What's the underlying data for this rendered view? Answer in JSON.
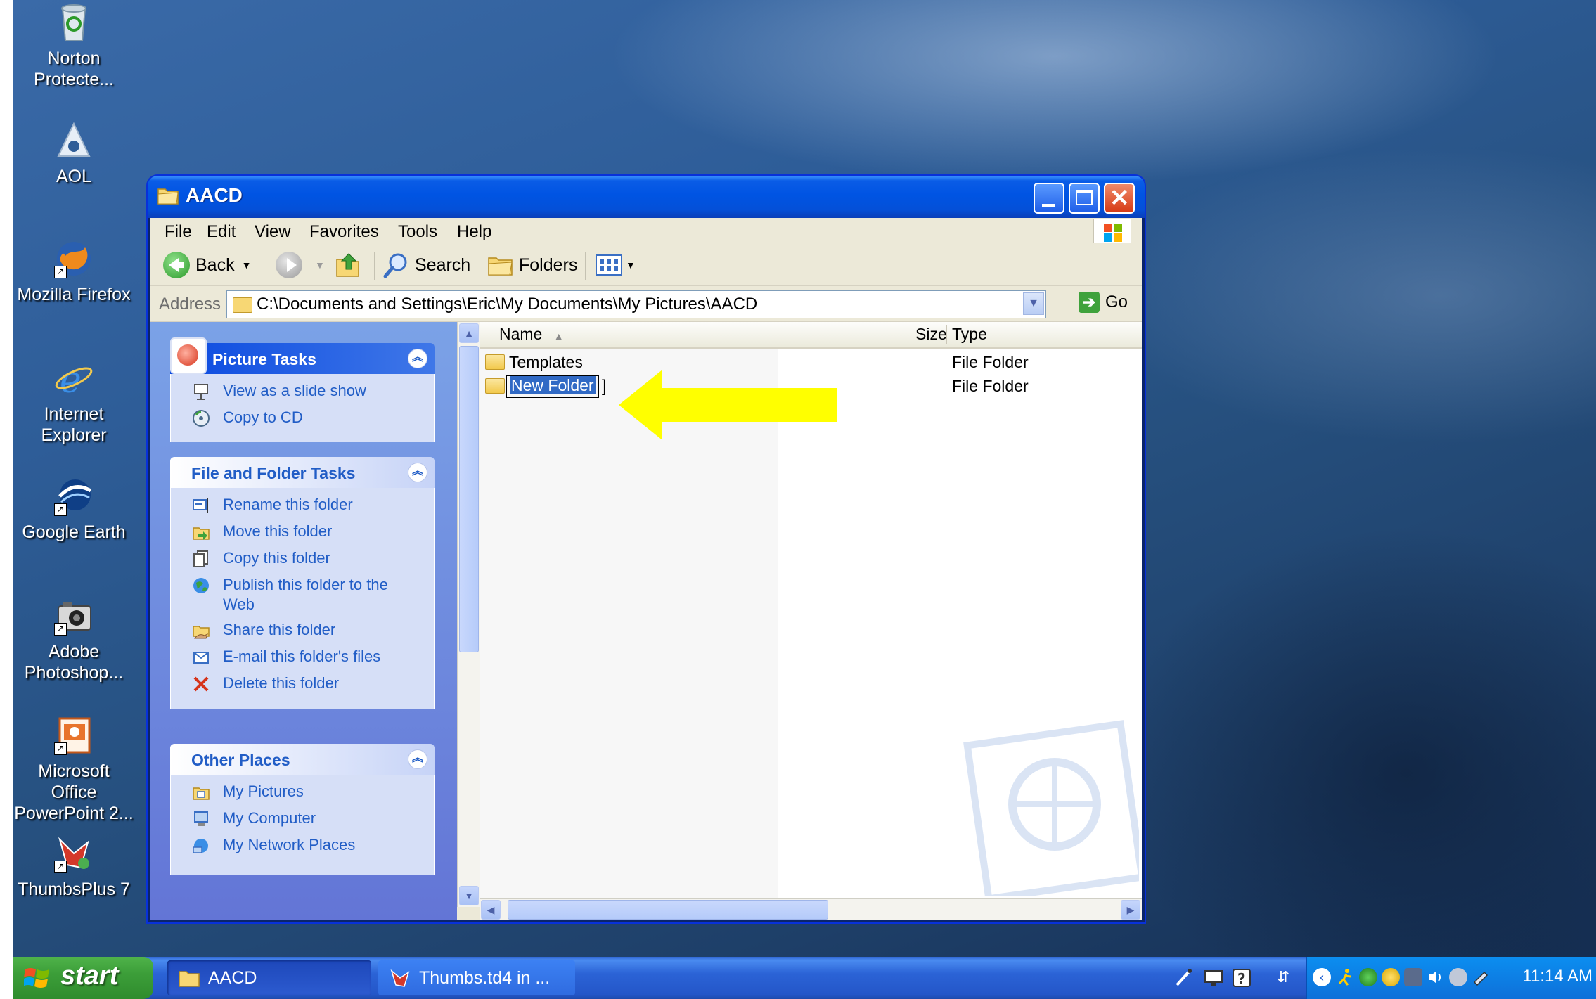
{
  "desktop": {
    "icons": [
      {
        "label": "Norton\nProtecte...",
        "icon": "recycle-bin-icon"
      },
      {
        "label": "AOL",
        "icon": "aol-icon"
      },
      {
        "label": "Mozilla Firefox",
        "icon": "firefox-icon"
      },
      {
        "label": "Internet\nExplorer",
        "icon": "internet-explorer-icon"
      },
      {
        "label": "Google Earth",
        "icon": "google-earth-icon"
      },
      {
        "label": "Adobe\nPhotoshop...",
        "icon": "photoshop-icon"
      },
      {
        "label": "Microsoft Office\nPowerPoint 2...",
        "icon": "powerpoint-icon"
      },
      {
        "label": "ThumbsPlus 7",
        "icon": "thumbsplus-icon"
      }
    ]
  },
  "window": {
    "title": "AACD",
    "menu": [
      "File",
      "Edit",
      "View",
      "Favorites",
      "Tools",
      "Help"
    ],
    "toolbar": {
      "back": "Back",
      "search": "Search",
      "folders": "Folders"
    },
    "address": {
      "label": "Address",
      "value": "C:\\Documents and Settings\\Eric\\My Documents\\My Pictures\\AACD",
      "go": "Go"
    },
    "task_pane": {
      "picture_tasks": {
        "title": "Picture Tasks",
        "items": [
          "View as a slide show",
          "Copy to CD"
        ]
      },
      "file_folder_tasks": {
        "title": "File and Folder Tasks",
        "items": [
          "Rename this folder",
          "Move this folder",
          "Copy this folder",
          "Publish this folder to the Web",
          "Share this folder",
          "E-mail this folder's files",
          "Delete this folder"
        ]
      },
      "other_places": {
        "title": "Other Places",
        "items": [
          "My Pictures",
          "My Computer",
          "My Network Places"
        ]
      }
    },
    "file_list": {
      "columns": {
        "name": "Name",
        "size": "Size",
        "type": "Type"
      },
      "sort": "name-ascending",
      "rows": [
        {
          "name": "Templates",
          "type": "File Folder"
        },
        {
          "name": "New Folder",
          "type": "File Folder",
          "renaming": true
        }
      ]
    }
  },
  "taskbar": {
    "start": "start",
    "tasks": [
      {
        "label": "AACD",
        "active": true
      },
      {
        "label": "Thumbs.td4 in ...",
        "active": false
      }
    ],
    "clock": "11:14 AM"
  },
  "colors": {
    "titlebar": "#0054e3",
    "taskpane_link": "#215dc6",
    "selection": "#316ac5",
    "annotation_arrow": "#ffff00",
    "start_button": "#3c9e39"
  }
}
